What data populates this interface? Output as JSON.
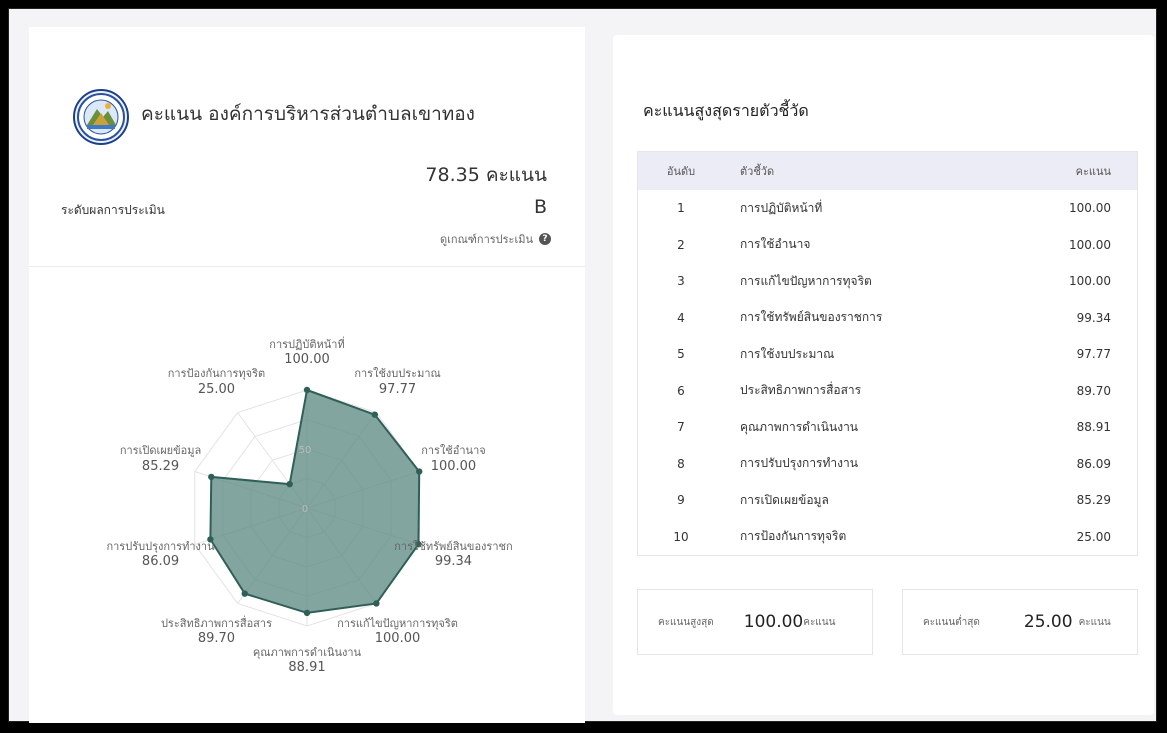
{
  "org": {
    "title": "คะแนน องค์การบริหารส่วนตำบลเขาทอง",
    "score_text": "78.35 คะแนน",
    "level_label": "ระดับผลการประเมิน",
    "level_value": "B",
    "criteria_link": "ดูเกณฑ์การประเมิน",
    "help_icon": "?"
  },
  "chart_data": {
    "type": "radar",
    "rmax": 100,
    "ticks": [
      0,
      50
    ],
    "fill_color": "#5f8c84",
    "stroke_color": "#2f5f57",
    "axes": [
      {
        "label": "การปฏิบัติหน้าที่",
        "value": 100.0,
        "display": "100.00"
      },
      {
        "label": "การใช้งบประมาณ",
        "value": 97.77,
        "display": "97.77"
      },
      {
        "label": "การใช้อำนาจ",
        "value": 100.0,
        "display": "100.00"
      },
      {
        "label": "การใช้ทรัพย์สินของราชก",
        "value": 99.34,
        "display": "99.34"
      },
      {
        "label": "การแก้ไขปัญหาการทุจริต",
        "value": 100.0,
        "display": "100.00"
      },
      {
        "label": "คุณภาพการดำเนินงาน",
        "value": 88.91,
        "display": "88.91"
      },
      {
        "label": "ประสิทธิภาพการสื่อสาร",
        "value": 89.7,
        "display": "89.70"
      },
      {
        "label": "การปรับปรุงการทำงาน",
        "value": 86.09,
        "display": "86.09"
      },
      {
        "label": "การเปิดเผยข้อมูล",
        "value": 85.29,
        "display": "85.29"
      },
      {
        "label": "การป้องกันการทุจริต",
        "value": 25.0,
        "display": "25.00"
      }
    ]
  },
  "ranking": {
    "title": "คะแนนสูงสุดรายตัวชี้วัด",
    "headers": {
      "rank": "อันดับ",
      "indicator": "ตัวชี้วัด",
      "score": "คะแนน"
    },
    "rows": [
      {
        "rank": "1",
        "name": "การปฏิบัติหน้าที่",
        "score": "100.00"
      },
      {
        "rank": "2",
        "name": "การใช้อำนาจ",
        "score": "100.00"
      },
      {
        "rank": "3",
        "name": "การแก้ไขปัญหาการทุจริต",
        "score": "100.00"
      },
      {
        "rank": "4",
        "name": "การใช้ทรัพย์สินของราชการ",
        "score": "99.34"
      },
      {
        "rank": "5",
        "name": "การใช้งบประมาณ",
        "score": "97.77"
      },
      {
        "rank": "6",
        "name": "ประสิทธิภาพการสื่อสาร",
        "score": "89.70"
      },
      {
        "rank": "7",
        "name": "คุณภาพการดำเนินงาน",
        "score": "88.91"
      },
      {
        "rank": "8",
        "name": "การปรับปรุงการทำงาน",
        "score": "86.09"
      },
      {
        "rank": "9",
        "name": "การเปิดเผยข้อมูล",
        "score": "85.29"
      },
      {
        "rank": "10",
        "name": "การป้องกันการทุจริต",
        "score": "25.00"
      }
    ]
  },
  "summary": {
    "max_label": "คะแนนสูงสุด",
    "max_value": "100.00",
    "max_unit": "คะแนน",
    "min_label": "คะแนนต่ำสุด",
    "min_value": "25.00",
    "min_unit": "คะแนน"
  }
}
